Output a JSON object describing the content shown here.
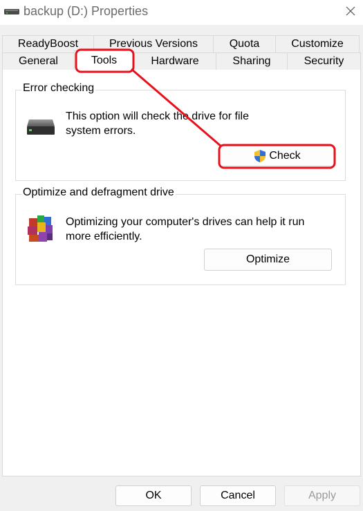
{
  "window": {
    "title": "backup (D:) Properties",
    "title_icon": "drive-icon",
    "close_icon": "close-icon"
  },
  "tabs": {
    "back_row": [
      "ReadyBoost",
      "Previous Versions",
      "Quota",
      "Customize"
    ],
    "front_row": [
      "General",
      "Tools",
      "Hardware",
      "Sharing",
      "Security"
    ],
    "active": "Tools"
  },
  "error_checking": {
    "title": "Error checking",
    "description_line1": "This option will check the drive for file",
    "description_line2": "system errors.",
    "button_label": "Check",
    "icon": "hard-drive-icon",
    "button_icon": "uac-shield-icon"
  },
  "optimize": {
    "title": "Optimize and defragment drive",
    "description_line1": "Optimizing your computer's drives can help it run",
    "description_line2": "more efficiently.",
    "button_label": "Optimize",
    "icon": "defrag-icon"
  },
  "footer": {
    "ok_label": "OK",
    "cancel_label": "Cancel",
    "apply_label": "Apply"
  },
  "annotations": {
    "highlight_color": "#e8101a",
    "targets": [
      "Tools",
      "Check"
    ]
  }
}
